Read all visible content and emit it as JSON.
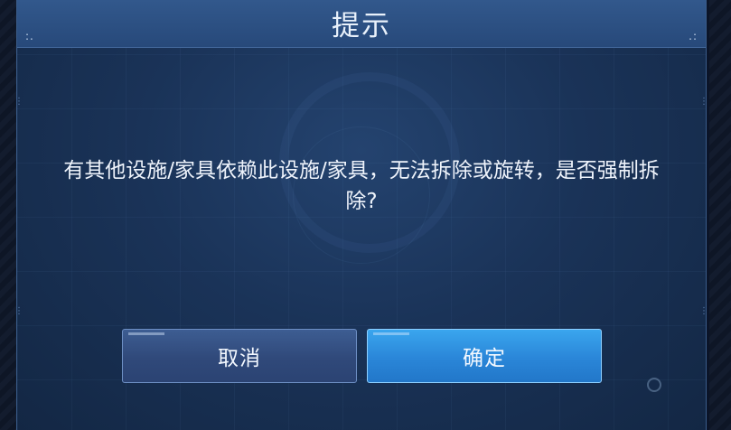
{
  "dialog": {
    "title": "提示",
    "corner_left": ":.",
    "corner_right": ".:",
    "message": "有其他设施/家具依赖此设施/家具，无法拆除或旋转，是否强制拆除?",
    "cancel_label": "取消",
    "confirm_label": "确定"
  },
  "colors": {
    "panel": "#1a3358",
    "title_bar": "#2c5083",
    "cancel_button": "#33507f",
    "confirm_button": "#2a86d8"
  }
}
